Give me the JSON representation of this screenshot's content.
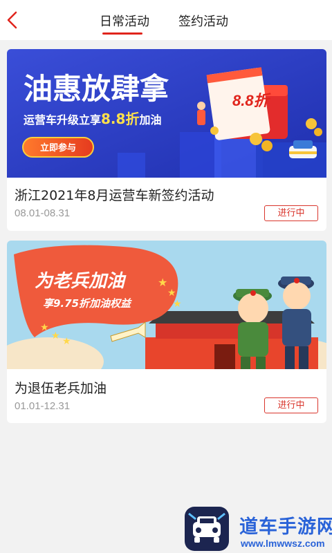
{
  "header": {
    "tabs": [
      {
        "label": "日常活动",
        "active": true
      },
      {
        "label": "签约活动",
        "active": false
      }
    ]
  },
  "activities": [
    {
      "banner": {
        "headline": "油惠放肆拿",
        "subline_prefix": "运营车升级立享",
        "subline_highlight": "8.8折",
        "subline_suffix": "加油",
        "button": "立即参与",
        "ticket": "8.8折"
      },
      "title": "浙江2021年8月运营车新签约活动",
      "date": "08.01-08.31",
      "status": "进行中"
    },
    {
      "banner": {
        "headline": "为老兵加油",
        "subline": "享9.75折加油权益"
      },
      "title": "为退伍老兵加油",
      "date": "01.01-12.31",
      "status": "进行中"
    }
  ],
  "watermark": {
    "name": "道车手游网",
    "url": "www.lmwwsz.com"
  },
  "colors": {
    "accent": "#e0241c",
    "banner1_bg": "#2438c8",
    "banner2_bg": "#a9d9ee",
    "watermark": "#2a63d8"
  }
}
